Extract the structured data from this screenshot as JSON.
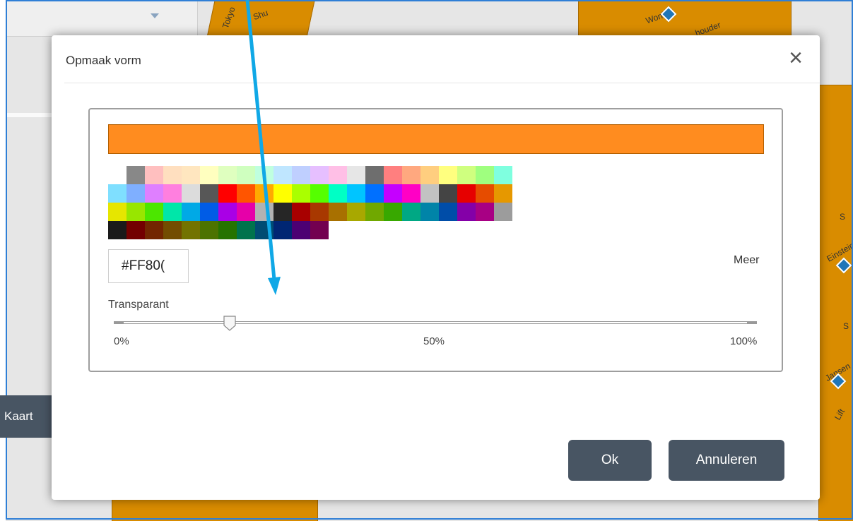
{
  "map": {
    "kaart_button_label": "Kaart",
    "street_labels": [
      "Tokyo",
      "Shu",
      "Woning",
      "houder",
      "Einstein",
      "Jansen",
      "Lift",
      "S",
      "S"
    ]
  },
  "dialog": {
    "title": "Opmaak vorm",
    "close_icon": "close-icon",
    "selected_color": "#FF8C1F",
    "hex_value": "#FF80(",
    "more_label": "Meer",
    "transparency": {
      "label": "Transparant",
      "value_percent": 18,
      "ticks": [
        "0%",
        "50%",
        "100%"
      ]
    },
    "palette": [
      [
        "#FFFFFF",
        "#888888",
        "#FFBFBF",
        "#FFDFBF",
        "#FFE6BF",
        "#FFFFBF",
        "#DFFFBF",
        "#CFFFBF",
        "#BFFFDF",
        "#BFE6FF",
        "#BFCFFF",
        "#E6BFFF",
        "#FFBFE6",
        "#E6E6E6",
        "#6E6E6E",
        "#FF7F7F",
        "#FFA87F",
        "#FFCE7F",
        "#FFFF7F",
        "#CFFF7F",
        "#9FFF7F",
        "#7FFFDF"
      ],
      [
        "#7FDFFF",
        "#7FAFFF",
        "#DF7FFF",
        "#FF7FDF",
        "#DCDCDC",
        "#575757",
        "#FF0000",
        "#FF5500",
        "#FFAA00",
        "#FFFF00",
        "#AAFF00",
        "#55FF00",
        "#00FFC5",
        "#00C5FF",
        "#0070FF",
        "#C500FF",
        "#FF00C5",
        "#C2C2C2",
        "#444444",
        "#E60000",
        "#E64C00",
        "#E69800"
      ],
      [
        "#E6E600",
        "#98E600",
        "#4CE600",
        "#00E6A9",
        "#00A9E6",
        "#005CE6",
        "#A900E6",
        "#E600A9",
        "#B2B2B2",
        "#262626",
        "#A80000",
        "#A83800",
        "#A87000",
        "#A8A800",
        "#70A800",
        "#38A800",
        "#00A884",
        "#0084A8",
        "#004DA8",
        "#8400A8",
        "#A80084",
        "#9C9C9C"
      ],
      [
        "#1A1A1A",
        "#730000",
        "#732600",
        "#734C00",
        "#737300",
        "#4C7300",
        "#267300",
        "#00734C",
        "#004C73",
        "#002673",
        "#4C0073",
        "#730050"
      ]
    ],
    "ok_label": "Ok",
    "cancel_label": "Annuleren"
  }
}
